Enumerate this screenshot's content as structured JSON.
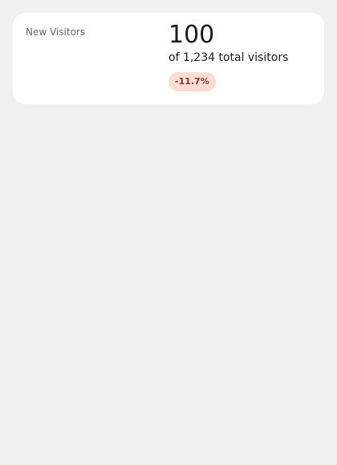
{
  "card": {
    "title": "New Visitors",
    "value": "100",
    "subtitle": "of 1,234 total visitors",
    "change": "-11.7%",
    "change_direction": "down"
  },
  "colors": {
    "page_background": "#f0f0f0",
    "card_background": "#ffffff",
    "negative_badge_background": "#fddcd3",
    "negative_badge_text": "#7a3a2c"
  }
}
